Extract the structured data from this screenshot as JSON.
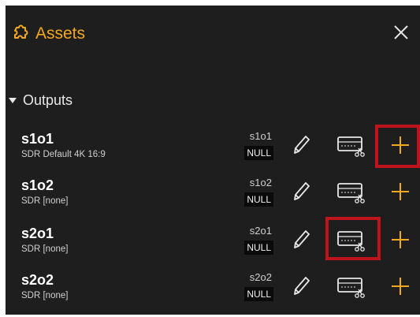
{
  "header": {
    "title": "Assets",
    "icon": "puzzle-icon",
    "close_icon": "close-icon",
    "accent": "#f4a81c"
  },
  "section": {
    "title": "Outputs"
  },
  "rows": [
    {
      "name": "s1o1",
      "subtitle": "SDR  Default 4K 16:9",
      "id": "s1o1",
      "badge": "NULL"
    },
    {
      "name": "s1o2",
      "subtitle": "SDR  [none]",
      "id": "s1o2",
      "badge": "NULL"
    },
    {
      "name": "s2o1",
      "subtitle": "SDR  [none]",
      "id": "s2o1",
      "badge": "NULL"
    },
    {
      "name": "s2o2",
      "subtitle": "SDR  [none]",
      "id": "s2o2",
      "badge": "NULL"
    }
  ],
  "icons": {
    "edit": "pencil-icon",
    "cut": "clip-scissors-icon",
    "add": "plus-icon"
  },
  "colors": {
    "panel_bg": "#1e1e1e",
    "highlight": "#c0141c",
    "plus": "#f4a81c"
  }
}
